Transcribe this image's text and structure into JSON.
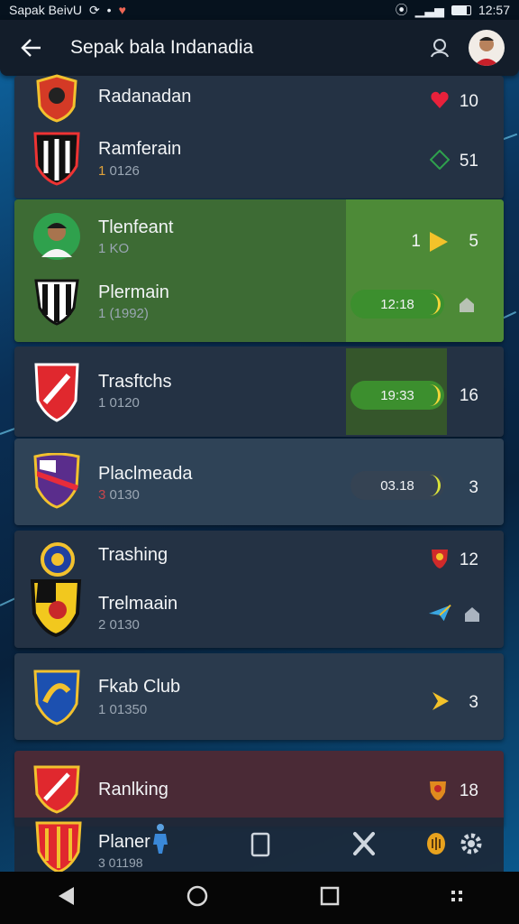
{
  "status_bar": {
    "left_text": "Sapak BeivU",
    "time": "12:57"
  },
  "app_bar": {
    "title": "Sepak bala Indanadia"
  },
  "rows": [
    {
      "name": "Radanadan",
      "sub": "",
      "number": "10",
      "indicator": "heart-icon"
    },
    {
      "name": "Ramferain",
      "sub_hl": "1",
      "sub": " 0126",
      "number": "51",
      "indicator": "diamond-outline-icon"
    },
    {
      "name": "Tlenfeant",
      "sub": "1 KO",
      "pre_number": "1",
      "number": "5",
      "indicator": "play-arrow-icon"
    },
    {
      "name": "Plermain",
      "sub": "1 (1992)",
      "pill": "12:18",
      "indicator": "home-icon"
    },
    {
      "name": "Trasftchs",
      "sub": "1 0120",
      "pill": "19:33",
      "number": "16"
    },
    {
      "name": "Placlmeada",
      "sub_hl": "3",
      "sub": " 0130",
      "pill": "03.18",
      "number": "3"
    },
    {
      "name": "Trashing",
      "sub": "",
      "number": "12",
      "indicator": "crest-small-icon"
    },
    {
      "name": "Trelmaain",
      "sub": "2 0130",
      "indicator": "paper-plane-icon",
      "indicator2": "home-icon"
    },
    {
      "name": "Fkab Club",
      "sub": "1 01350",
      "number": "3",
      "indicator": "star-icon"
    },
    {
      "name": "Ranlking",
      "sub": "",
      "number": "18",
      "indicator": "crest-small-icon"
    },
    {
      "name": "Planer",
      "sub": "3 01198"
    }
  ],
  "colors": {
    "card": "#243244",
    "highlight": "#3d6b34",
    "highlight_strong": "#4d8a37",
    "ranking_card": "#4a2a36",
    "accent_yellow": "#f3c22a"
  }
}
